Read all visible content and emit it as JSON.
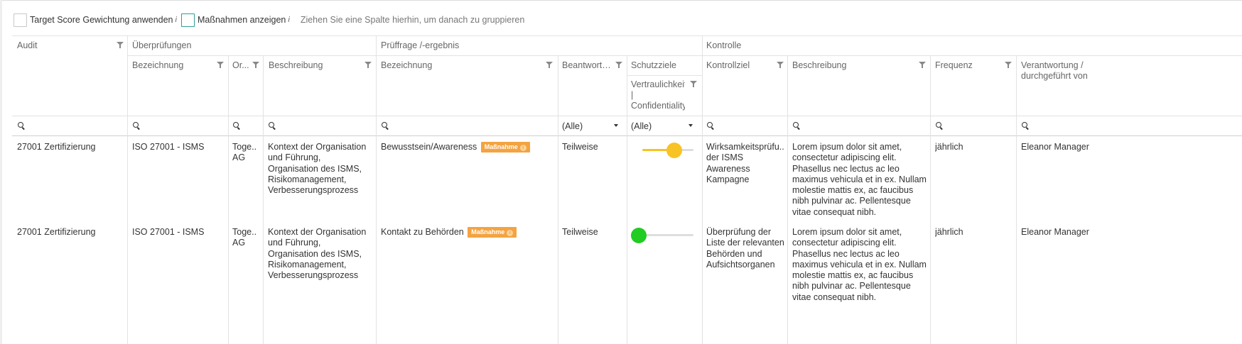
{
  "toolbar": {
    "target_score_label": "Target Score Gewichtung anwenden",
    "target_score_info": "i",
    "massnahmen_label": "Maßnahmen anzeigen",
    "massnahmen_info": "i",
    "group_hint": "Ziehen Sie eine Spalte hierhin, um danach zu gruppieren"
  },
  "header": {
    "groups": {
      "audit": "Audit",
      "ueberpruefungen": "Überprüfungen",
      "prueffrage": "Prüffrage /-ergebnis",
      "kontrolle": "Kontrolle"
    },
    "columns": {
      "bezeichnung1": "Bezeichnung",
      "org": "Or...",
      "beschreibung1": "Beschreibung",
      "bezeichnung2": "Bezeichnung",
      "beantwortung": "Beantwortu...",
      "schutzziele": "Schutzziele",
      "vertraulichkeit": "Vertraulichkeit | Confidentiality",
      "kontrollziel": "Kontrollziel",
      "beschreibung2": "Beschreibung",
      "frequenz": "Frequenz",
      "verantwortung": "Verantwortung / durchgeführt von"
    },
    "filters": {
      "beantwortung_value": "(Alle)",
      "vertraulichkeit_value": "(Alle)"
    }
  },
  "rows": [
    {
      "audit": "27001 Zertifizierung",
      "bezeichnung1": "ISO 27001 - ISMS",
      "org": "Toge... AG",
      "beschreibung1": "Kontext der Organisation und Führung, Organisation des ISMS, Risikomanagement, Verbesserungsprozess",
      "bezeichnung2": "Bewusstsein/Awareness",
      "badge": "Maßnahme",
      "beantwortung": "Teilweise",
      "slider_value": 0.68,
      "slider_color": "#f7c325",
      "kontrollziel": "Wirksamkeitsprüfu... der ISMS Awareness Kampagne",
      "beschreibung2": "Lorem ipsum dolor sit amet, consectetur adipiscing elit. Phasellus nec lectus ac leo maximus vehicula et in ex. Nullam molestie mattis ex, ac faucibus nibh pulvinar ac. Pellentesque vitae consequat nibh.",
      "frequenz": "jährlich",
      "verantwortung": "Eleanor Manager"
    },
    {
      "audit": "27001 Zertifizierung",
      "bezeichnung1": "ISO 27001 - ISMS",
      "org": "Toge... AG",
      "beschreibung1": "Kontext der Organisation und Führung, Organisation des ISMS, Risikomanagement, Verbesserungsprozess",
      "bezeichnung2": "Kontakt zu Behörden",
      "badge": "Maßnahme",
      "beantwortung": "Teilweise",
      "slider_value": 0.0,
      "slider_color": "#22cc22",
      "kontrollziel": "Überprüfung der Liste der relevanten Behörden und Aufsichtsorganen",
      "beschreibung2": "Lorem ipsum dolor sit amet, consectetur adipiscing elit. Phasellus nec lectus ac leo maximus vehicula et in ex. Nullam molestie mattis ex, ac faucibus nibh pulvinar ac. Pellentesque vitae consequat nibh.",
      "frequenz": "jährlich",
      "verantwortung": "Eleanor Manager"
    }
  ]
}
